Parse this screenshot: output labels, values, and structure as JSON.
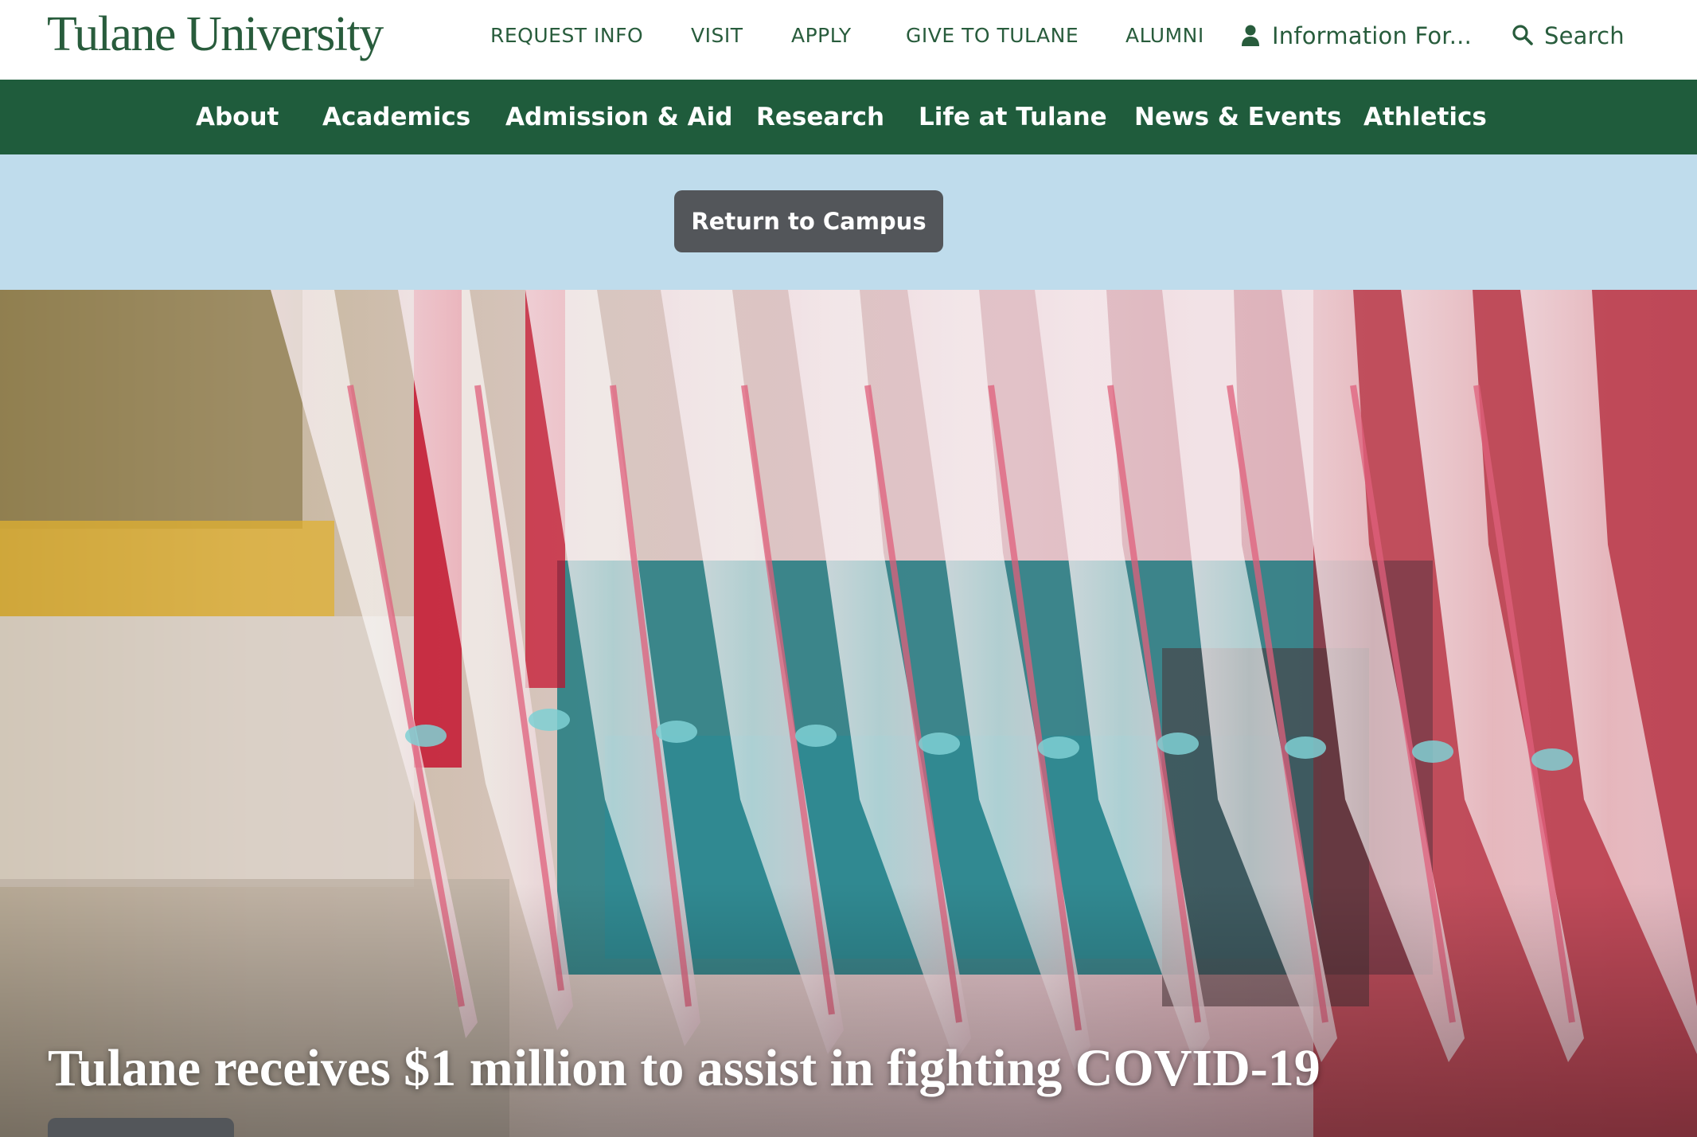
{
  "brand": {
    "logo_text": "Tulane University",
    "primary_green": "#1f5c3c",
    "logo_green": "#285c3c",
    "alert_blue": "#bfdcec",
    "button_gray": "#53565a"
  },
  "utility_nav": {
    "request_info": "REQUEST INFO",
    "visit": "VISIT",
    "apply": "APPLY",
    "give": "GIVE TO TULANE",
    "alumni": "ALUMNI",
    "information_for": "Information For...",
    "information_for_icon": "person-icon",
    "search": "Search",
    "search_icon": "search-icon"
  },
  "main_nav": {
    "about": "About",
    "academics": "Academics",
    "admission": "Admission & Aid",
    "research": "Research",
    "life": "Life at Tulane",
    "news": "News & Events",
    "athletics": "Athletics"
  },
  "alert": {
    "button_label": "Return to Campus"
  },
  "hero": {
    "headline": "Tulane receives $1 million to assist in fighting COVID-19",
    "image_subject": "row of pipette tips with pink and blue liquid"
  }
}
